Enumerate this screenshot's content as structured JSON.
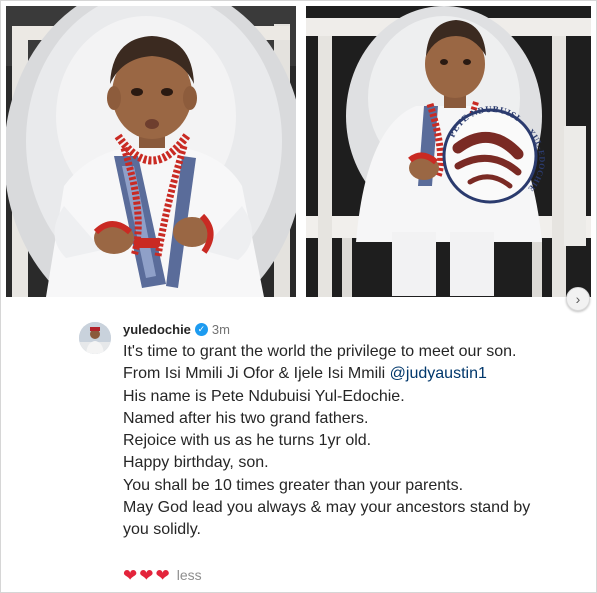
{
  "post": {
    "username": "yuledochie",
    "verified_mark": "✓",
    "time": "3m",
    "caption_lines": [
      "It's time to grant the world the privilege to meet our son.",
      "From Isi Mmili Ji Ofor & Ijele Isi Mmili ",
      "His name is Pete Ndubuisi Yul-Edochie.",
      "Named after his two grand fathers.",
      "Rejoice with us as he turns 1yr old.",
      "Happy birthday, son.",
      "You shall be 10 times greater than your parents.",
      "May God lead you always & may your ancestors stand by you solidly."
    ],
    "mention": "@judyaustin1",
    "hearts": [
      "❤",
      "❤",
      "❤"
    ],
    "less_label": "less",
    "next_arrow": "›"
  },
  "photo_right": {
    "fan_text_top": "PETE NDUBUISI",
    "fan_text_side": "YUL-EDOCHIE"
  },
  "icons": {
    "next": "chevron-right-icon",
    "verified": "verified-badge-icon",
    "heart": "red-heart-icon"
  },
  "colors": {
    "text": "#262626",
    "muted": "#737373",
    "mention": "#00376b",
    "verified": "#1d9bf0",
    "heart": "#e3243b"
  }
}
